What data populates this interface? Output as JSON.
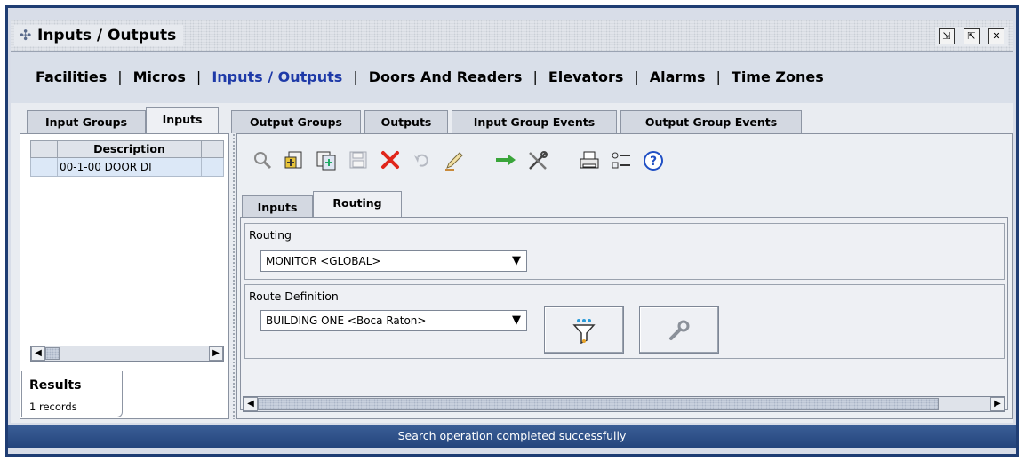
{
  "window": {
    "title": "Inputs / Outputs",
    "icon": "puzzle-icon",
    "controls": [
      "restore-icon",
      "maximize-icon",
      "close-icon"
    ]
  },
  "main_nav": {
    "items": [
      "Facilities",
      "Micros",
      "Inputs / Outputs",
      "Doors And Readers",
      "Elevators",
      "Alarms",
      "Time Zones"
    ],
    "active": "Inputs / Outputs"
  },
  "left_tabs": [
    "Input Groups",
    "Inputs"
  ],
  "left_tabs_selected": "Inputs",
  "right_tabs": [
    "Output Groups",
    "Outputs",
    "Input Group Events",
    "Output Group Events"
  ],
  "grid": {
    "column": "Description",
    "rows": [
      "00-1-00 DOOR DI"
    ]
  },
  "results": {
    "label": "Results",
    "count": "1 records"
  },
  "toolbar": {
    "icons": [
      "search-icon",
      "add-icon",
      "copy-icon",
      "save-icon",
      "delete-icon",
      "undo-icon",
      "edit-icon",
      "arrow-icon",
      "tools-icon",
      "print-icon",
      "list-icon",
      "help-icon"
    ]
  },
  "sub_tabs": [
    "Inputs",
    "Routing"
  ],
  "sub_tabs_selected": "Routing",
  "routing": {
    "label": "Routing",
    "value": "MONITOR <GLOBAL>"
  },
  "route_definition": {
    "label": "Route Definition",
    "value": "BUILDING ONE <Boca Raton>"
  },
  "status": "Search operation completed successfully",
  "colors": {
    "frame": "#1f3d73",
    "active_nav": "#1e3aa8",
    "status_bar": "#2e4f87",
    "delete_red": "#e0261a",
    "arrow_green": "#3aa53a",
    "help_blue": "#1f4fc4"
  }
}
